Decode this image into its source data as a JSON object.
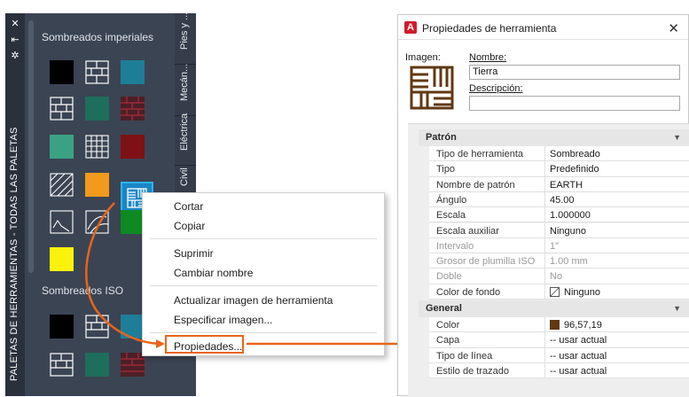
{
  "palette": {
    "vertical_title": "PALETAS DE HERRAMIENTAS - TODAS LAS PALETAS",
    "sections": [
      {
        "title": "Sombreados imperiales"
      },
      {
        "title": "Sombreados ISO"
      }
    ],
    "tabs": [
      "Pies y ...",
      "Mecán...",
      "Eléctrica",
      "Civil"
    ],
    "toolbar_icons": [
      "close-icon",
      "pin-icon",
      "properties-icon"
    ]
  },
  "context_menu": {
    "items": [
      "Cortar",
      "Copiar",
      "Suprimir",
      "Cambiar nombre",
      "Actualizar imagen de herramienta",
      "Especificar imagen...",
      "Propiedades..."
    ]
  },
  "dialog": {
    "title": "Propiedades de herramienta",
    "image_label": "Imagen:",
    "name_label": "Nombre:",
    "name_value": "Tierra",
    "description_label": "Descripción:",
    "description_value": "",
    "categories": [
      {
        "name": "Patrón",
        "rows": [
          {
            "name": "Tipo de herramienta",
            "value": "Sombreado",
            "enabled": true
          },
          {
            "name": "Tipo",
            "value": "Predefinido",
            "enabled": true
          },
          {
            "name": "Nombre de patrón",
            "value": "EARTH",
            "enabled": true
          },
          {
            "name": "Ángulo",
            "value": "45.00",
            "enabled": true
          },
          {
            "name": "Escala",
            "value": "1.000000",
            "enabled": true
          },
          {
            "name": "Escala auxiliar",
            "value": "Ninguno",
            "enabled": true
          },
          {
            "name": "Intervalo",
            "value": "1\"",
            "enabled": false
          },
          {
            "name": "Grosor de plumilla ISO",
            "value": "1.00 mm",
            "enabled": false
          },
          {
            "name": "Doble",
            "value": "No",
            "enabled": false
          },
          {
            "name": "Color de fondo",
            "value": "Ninguno",
            "enabled": true
          }
        ]
      },
      {
        "name": "General",
        "rows": [
          {
            "name": "Color",
            "value": "96,57,19",
            "enabled": true
          },
          {
            "name": "Capa",
            "value": "-- usar actual",
            "enabled": true
          },
          {
            "name": "Tipo de línea",
            "value": "-- usar actual",
            "enabled": true
          },
          {
            "name": "Estilo de trazado",
            "value": "-- usar actual",
            "enabled": true
          }
        ]
      }
    ]
  },
  "colors": {
    "palette_bg": "#3b4453",
    "accent_orange": "#e8651a",
    "earth_brown": "#603913",
    "selection_blue": "#1a86c8"
  }
}
